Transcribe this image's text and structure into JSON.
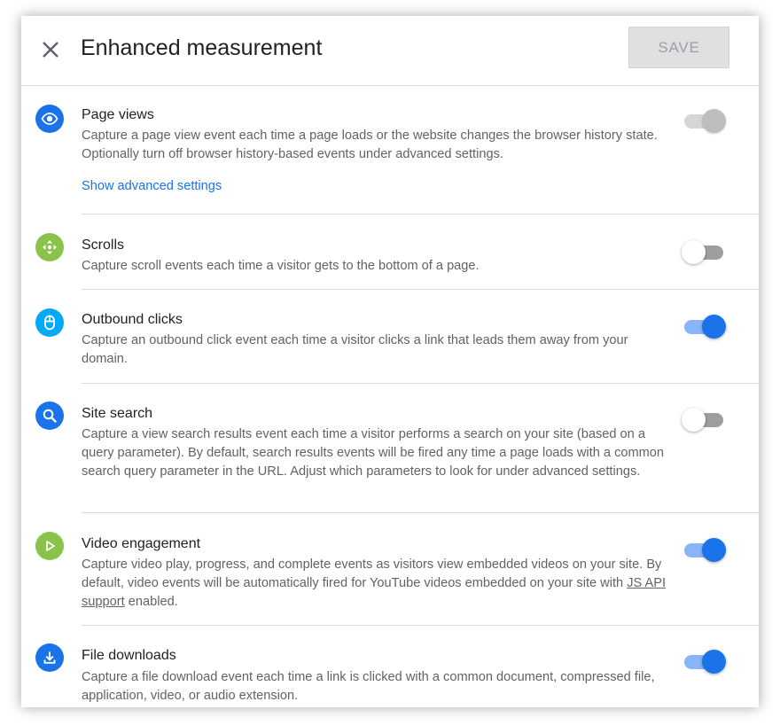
{
  "header": {
    "title": "Enhanced measurement",
    "save_label": "SAVE"
  },
  "sections": [
    {
      "title": "Page views",
      "description": "Capture a page view event each time a page loads or the website changes the browser history state. Optionally turn off browser history-based events under advanced settings.",
      "link": "Show advanced settings",
      "icon": "eye-icon",
      "icon_color": "#1a73e8",
      "toggle": "on-disabled"
    },
    {
      "title": "Scrolls",
      "description": "Capture scroll events each time a visitor gets to the bottom of a page.",
      "icon": "scroll-icon",
      "icon_color": "#8bc34a",
      "toggle": "off"
    },
    {
      "title": "Outbound clicks",
      "description": "Capture an outbound click event each time a visitor clicks a link that leads them away from your domain.",
      "icon": "mouse-icon",
      "icon_color": "#03a9f4",
      "toggle": "on"
    },
    {
      "title": "Site search",
      "description": "Capture a view search results event each time a visitor performs a search on your site (based on a query parameter). By default, search results events will be fired any time a page loads with a common search query parameter in the URL. Adjust which parameters to look for under advanced settings.",
      "icon": "search-icon",
      "icon_color": "#1a73e8",
      "toggle": "off"
    },
    {
      "title": "Video engagement",
      "description_before": "Capture video play, progress, and complete events as visitors view embedded videos on your site. By default, video events will be automatically fired for YouTube videos embedded on your site with ",
      "description_link": "JS API support",
      "description_after": " enabled.",
      "icon": "play-icon",
      "icon_color": "#8bc34a",
      "toggle": "on"
    },
    {
      "title": "File downloads",
      "description": "Capture a file download event each time a link is clicked with a common document, compressed file, application, video, or audio extension.",
      "icon": "download-icon",
      "icon_color": "#1a73e8",
      "toggle": "on"
    }
  ]
}
